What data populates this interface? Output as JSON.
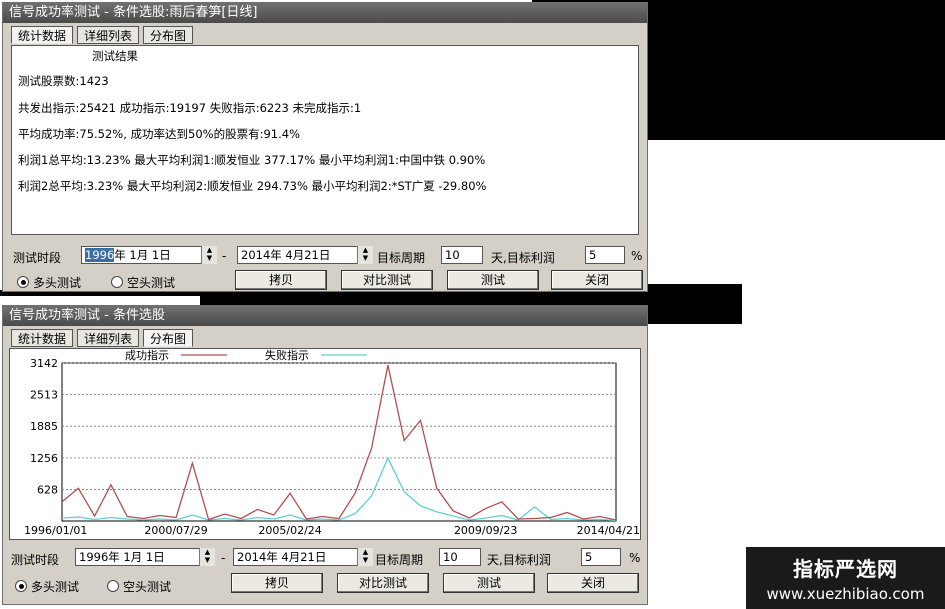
{
  "top_window": {
    "title": "信号成功率测试 - 条件选股:雨后春笋[日线]",
    "tabs": [
      {
        "label": "统计数据",
        "active": true
      },
      {
        "label": "详细列表",
        "active": false
      },
      {
        "label": "分布图",
        "active": false
      }
    ],
    "results": {
      "heading": "测试结果",
      "stock_count": "测试股票数:1423",
      "signals": "共发出指示:25421 成功指示:19197 失败指示:6223 未完成指示:1",
      "success_rate": "平均成功率:75.52%, 成功率达到50%的股票有:91.4%",
      "profit1": "利润1总平均:13.23% 最大平均利润1:顺发恒业 377.17% 最小平均利润1:中国中铁 0.90%",
      "profit2": "利润2总平均:3.23% 最大平均利润2:顺发恒业 294.73% 最小平均利润2:*ST广夏  -29.80%"
    },
    "period_label": "测试时段",
    "start_year": "1996",
    "start_rest": "年  1月  1日",
    "dash": "-",
    "end_date": "2014年  4月21日",
    "target_period_label": "目标周期",
    "target_period": "10",
    "target_profit_label": "天,目标利润",
    "target_profit": "5",
    "percent": "%",
    "long_test": "多头测试",
    "short_test": "空头测试",
    "buttons": {
      "copy": "拷贝",
      "compare": "对比测试",
      "test": "测试",
      "close": "关闭"
    }
  },
  "bottom_window": {
    "title": "信号成功率测试 - 条件选股",
    "tabs": [
      {
        "label": "统计数据",
        "active": false
      },
      {
        "label": "详细列表",
        "active": false
      },
      {
        "label": "分布图",
        "active": true
      }
    ],
    "start_date": "1996年  1月  1日",
    "dash": "-",
    "end_date": "2014年  4月21日",
    "period_label": "测试时段",
    "target_period_label": "目标周期",
    "target_period": "10",
    "target_profit_label": "天,目标利润",
    "target_profit": "5",
    "percent": "%",
    "long_test": "多头测试",
    "short_test": "空头测试",
    "buttons": {
      "copy": "拷贝",
      "compare": "对比测试",
      "test": "测试",
      "close": "关闭"
    }
  },
  "chart_data": {
    "type": "line",
    "x": [
      "1996/01/01",
      "1996/09",
      "1997/05",
      "1998/01",
      "1998/09",
      "1999/05",
      "2000/01",
      "2000/07/29",
      "2001/03",
      "2001/11",
      "2002/07",
      "2003/03",
      "2003/11",
      "2004/07",
      "2005/02/24",
      "2005/10",
      "2006/06",
      "2007/02",
      "2007/05",
      "2007/08",
      "2007/11",
      "2008/03",
      "2008/07",
      "2008/11",
      "2009/03",
      "2009/07",
      "2009/09/23",
      "2010/01",
      "2010/07",
      "2011/03",
      "2011/11",
      "2012/07",
      "2013/03",
      "2013/11",
      "2014/04/21"
    ],
    "series": [
      {
        "name": "成功指示",
        "color": "#b05050",
        "values": [
          380,
          650,
          100,
          720,
          90,
          50,
          110,
          70,
          1150,
          30,
          140,
          50,
          230,
          120,
          550,
          40,
          90,
          50,
          560,
          1450,
          3100,
          1600,
          2000,
          650,
          200,
          60,
          250,
          380,
          40,
          50,
          70,
          170,
          40,
          90,
          20
        ]
      },
      {
        "name": "失败指示",
        "color": "#5fcfd6",
        "values": [
          60,
          80,
          30,
          70,
          40,
          20,
          40,
          20,
          120,
          20,
          50,
          20,
          70,
          40,
          120,
          20,
          40,
          20,
          150,
          500,
          1250,
          580,
          300,
          180,
          100,
          20,
          60,
          110,
          20,
          280,
          30,
          50,
          20,
          30,
          10
        ]
      }
    ],
    "y_ticks": [
      "628",
      "1256",
      "1885",
      "2513",
      "3142"
    ],
    "x_tick_labels": [
      "1996/01/01",
      "2000/07/29",
      "2005/02/24",
      "2009/09/23",
      "2014/04/21"
    ],
    "ylim": [
      0,
      3142
    ],
    "grid": true,
    "legend": "top"
  },
  "watermark": {
    "line1": "指标严选网",
    "line2": "www.xuezhibiao.com"
  }
}
